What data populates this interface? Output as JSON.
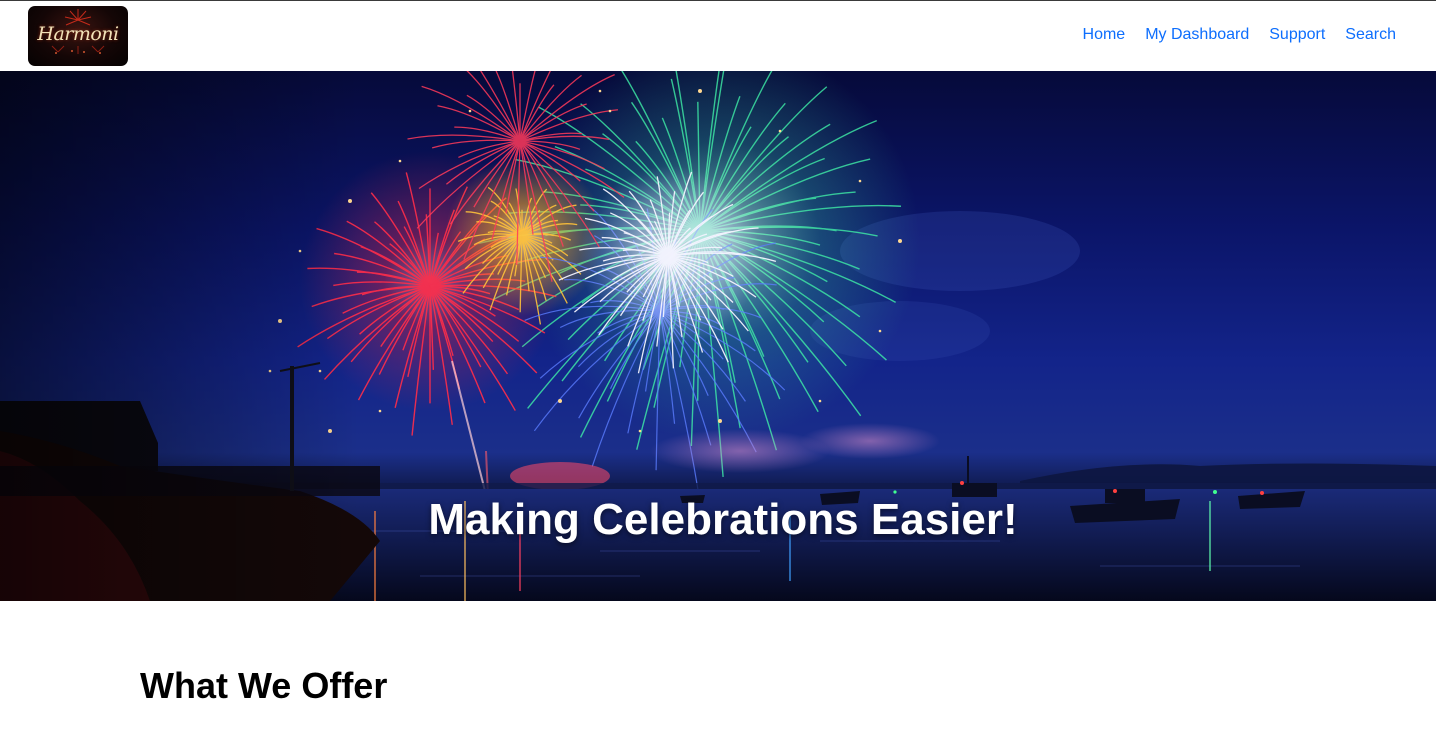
{
  "brand": {
    "logo_text": "Harmoni"
  },
  "nav": {
    "items": [
      {
        "label": "Home"
      },
      {
        "label": "My Dashboard"
      },
      {
        "label": "Support"
      },
      {
        "label": "Search"
      }
    ],
    "link_color": "#0d6efd"
  },
  "hero": {
    "title": "Making Celebrations Easier!",
    "image": "fireworks-over-harbor"
  },
  "offer": {
    "title": "What We Offer"
  }
}
